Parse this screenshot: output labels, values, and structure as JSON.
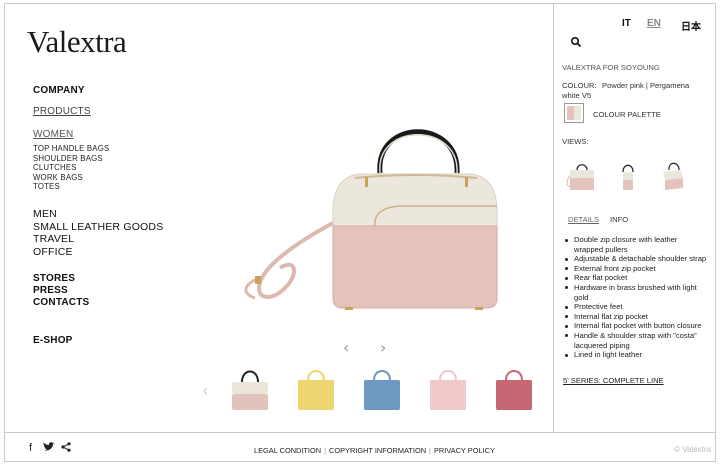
{
  "brand": {
    "logo": "Valextra"
  },
  "languages": [
    {
      "label": "IT",
      "selected": false
    },
    {
      "label": "EN",
      "selected": true
    },
    {
      "label": "日本",
      "selected": false
    }
  ],
  "nav": {
    "company": "COMPANY",
    "products": "PRODUCTS",
    "women": "WOMEN",
    "women_sub": [
      "TOP HANDLE BAGS",
      "SHOULDER BAGS",
      "CLUTCHES",
      "WORK BAGS",
      "TOTES"
    ],
    "men": "MEN",
    "small_leather_goods": "SMALL LEATHER GOODS",
    "travel": "TRAVEL",
    "office": "OFFICE",
    "stores": "STORES",
    "press": "PRESS",
    "contacts": "CONTACTS",
    "eshop": "E-SHOP"
  },
  "product": {
    "name": "VALEXTRA FOR SOYOUNG",
    "colour_label": "COLOUR:",
    "colour_line1": "Powder pink | Pergamena",
    "colour_line2": "white V5",
    "palette_label": "COLOUR PALETTE",
    "views_label": "VIEWS:",
    "tabs": [
      {
        "label": "DETAILS",
        "active": true
      },
      {
        "label": "INFO",
        "active": false
      }
    ],
    "details": [
      "Double zip closure with leather wrapped pullers",
      "Adjustable & detachable shoulder strap",
      "External front zip pocket",
      "Rear flat pocket",
      "Hardware in brass brushed with light gold",
      "Protective feet",
      "Internal flat zip pocket",
      "Internal flat pocket with button closure",
      "Handle & shoulder strap with \"costa\" lacquered piping",
      "Lined in light leather"
    ],
    "series_link": "5' SERIES: COMPLETE LINE"
  },
  "thumbnails": [
    {
      "name": "thumb-bag-powder-pink",
      "color": "#e2c2bd",
      "top": "#ece6da"
    },
    {
      "name": "thumb-bag-yellow",
      "color": "#eed56f",
      "top": "#eed56f"
    },
    {
      "name": "thumb-bag-blue",
      "color": "#6c98c2",
      "top": "#6c98c2"
    },
    {
      "name": "thumb-bag-pink",
      "color": "#f0c8c9",
      "top": "#f0c8c9"
    },
    {
      "name": "thumb-bag-red",
      "color": "#c86673",
      "top": "#c86673"
    }
  ],
  "colors": {
    "bag_pink": "#e4c3bc",
    "bag_cream": "#ece7dc",
    "text_muted": "#888888"
  },
  "footer": {
    "links": [
      "LEGAL CONDITION",
      "COPYRIGHT INFORMATION",
      "PRIVACY POLICY"
    ],
    "copyright": "© Valextra",
    "social_icons": [
      "facebook-icon",
      "twitter-icon",
      "share-icon"
    ]
  },
  "arrows": {
    "prev": "‹",
    "next": "›"
  }
}
